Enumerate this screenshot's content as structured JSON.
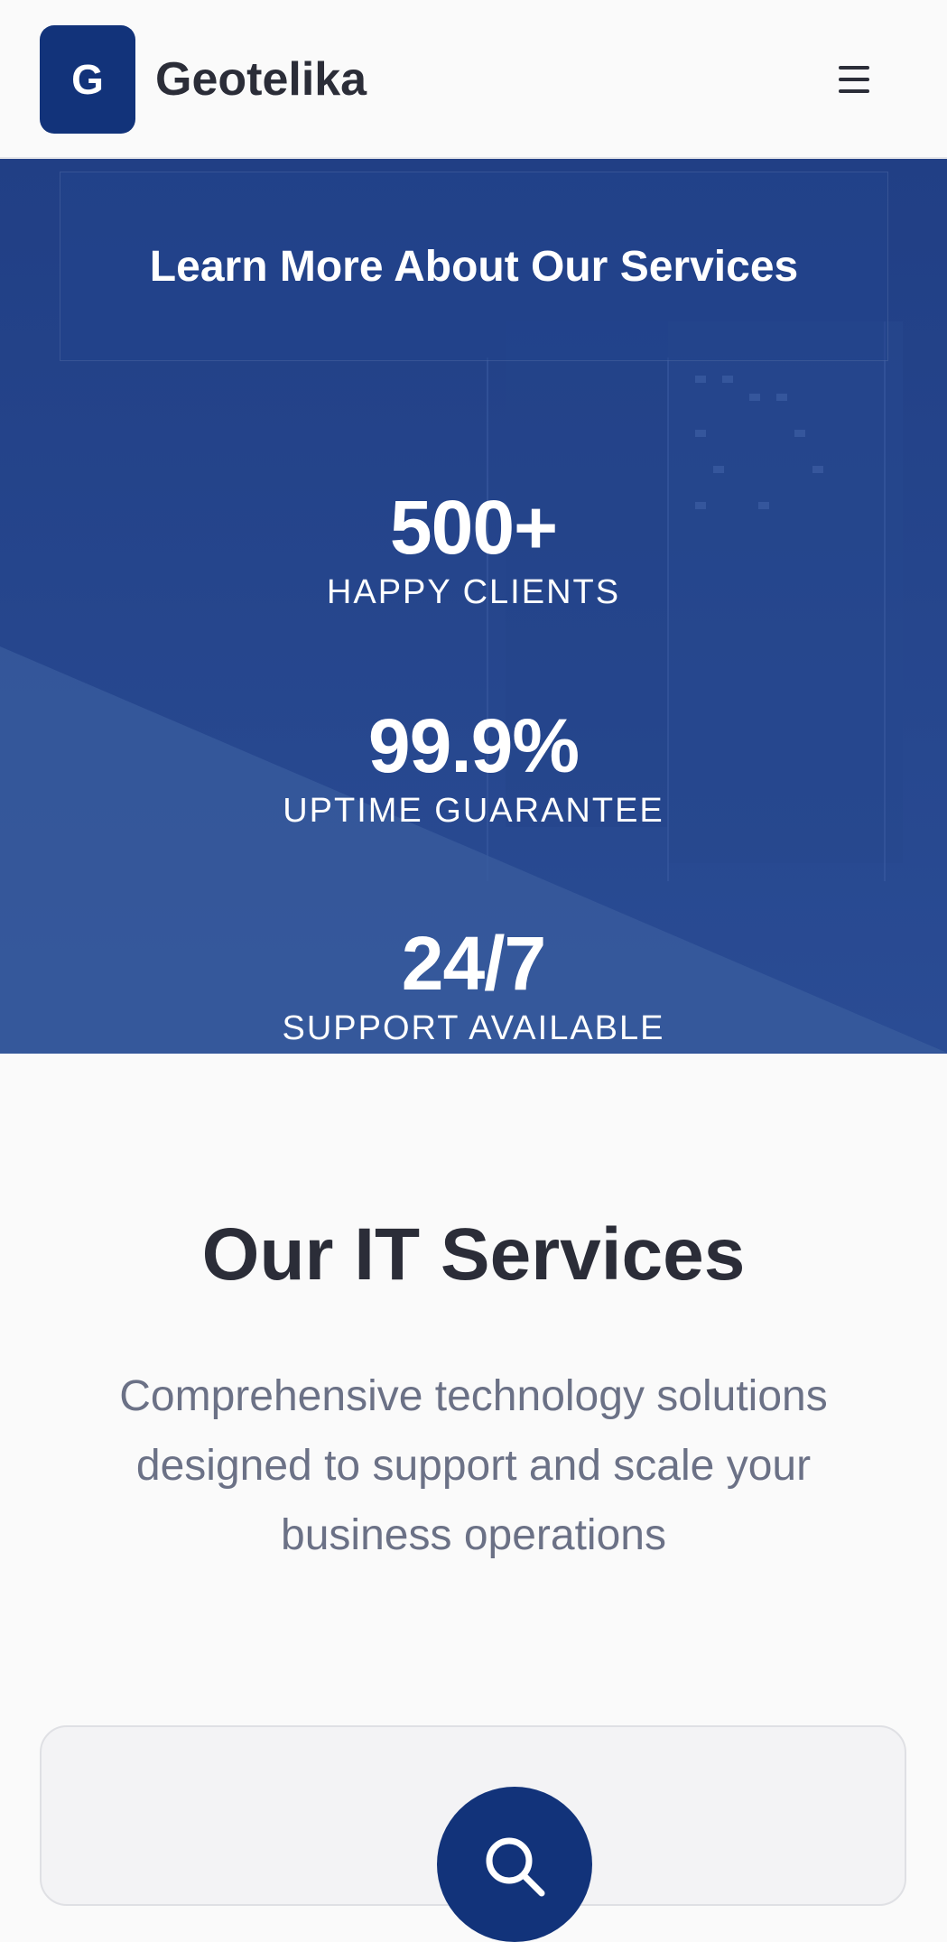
{
  "header": {
    "logo_letter": "G",
    "brand_name": "Geotelika",
    "menu_icon": "hamburger-menu-icon"
  },
  "hero": {
    "cta_label": "Learn More About Our Services",
    "stats": [
      {
        "value": "500+",
        "label": "HAPPY CLIENTS"
      },
      {
        "value": "99.9%",
        "label": "UPTIME GUARANTEE"
      },
      {
        "value": "24/7",
        "label": "SUPPORT AVAILABLE"
      }
    ]
  },
  "services": {
    "title": "Our IT Services",
    "subtitle": "Comprehensive technology solutions designed to support and scale your business operations",
    "first_card_icon": "search-icon"
  },
  "colors": {
    "brand": "#12337a",
    "hero": "#24478f",
    "text": "#2b2d38",
    "muted": "#6b7186"
  }
}
